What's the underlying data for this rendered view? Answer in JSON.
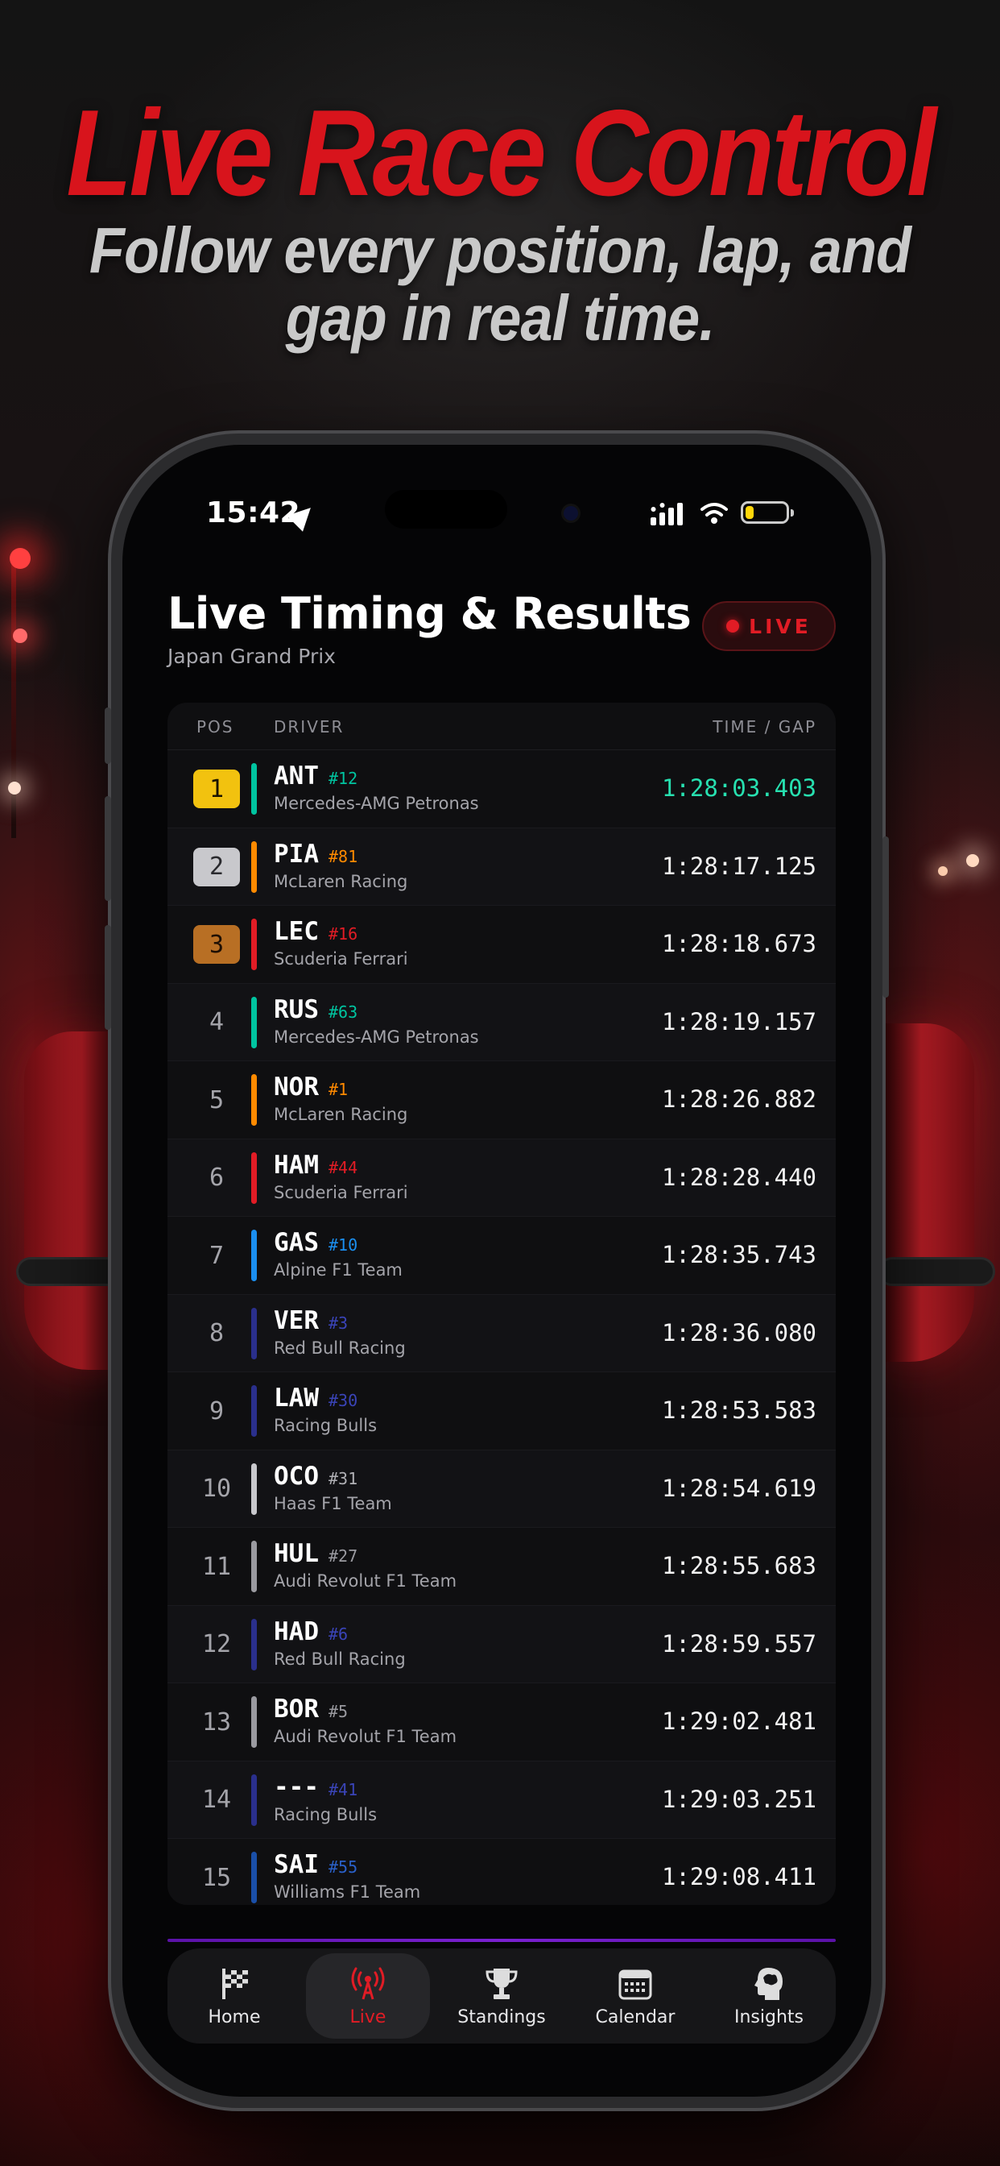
{
  "headline": {
    "title": "Live Race Control",
    "subtitle_line1": "Follow every position, lap, and",
    "subtitle_line2": "gap in real time."
  },
  "status_bar": {
    "time": "15:42"
  },
  "screen": {
    "title": "Live Timing & Results",
    "subtitle": "Japan Grand Prix",
    "live_badge": "LIVE"
  },
  "table": {
    "headers": {
      "pos": "POS",
      "driver": "DRIVER",
      "time": "TIME / GAP"
    },
    "rows": [
      {
        "pos": "1",
        "code": "ANT",
        "number": "#12",
        "team": "Mercedes-AMG Petronas",
        "time": "1:28:03.403",
        "team_color": "#00c4a0",
        "number_color": "#00c4a0",
        "leader": true
      },
      {
        "pos": "2",
        "code": "PIA",
        "number": "#81",
        "team": "McLaren Racing",
        "time": "1:28:17.125",
        "team_color": "#ff8a00",
        "number_color": "#ff8a00"
      },
      {
        "pos": "3",
        "code": "LEC",
        "number": "#16",
        "team": "Scuderia Ferrari",
        "time": "1:28:18.673",
        "team_color": "#e11c25",
        "number_color": "#e11c25"
      },
      {
        "pos": "4",
        "code": "RUS",
        "number": "#63",
        "team": "Mercedes-AMG Petronas",
        "time": "1:28:19.157",
        "team_color": "#00c4a0",
        "number_color": "#00c4a0"
      },
      {
        "pos": "5",
        "code": "NOR",
        "number": "#1",
        "team": "McLaren Racing",
        "time": "1:28:26.882",
        "team_color": "#ff8a00",
        "number_color": "#ff8a00"
      },
      {
        "pos": "6",
        "code": "HAM",
        "number": "#44",
        "team": "Scuderia Ferrari",
        "time": "1:28:28.440",
        "team_color": "#e11c25",
        "number_color": "#e11c25"
      },
      {
        "pos": "7",
        "code": "GAS",
        "number": "#10",
        "team": "Alpine F1 Team",
        "time": "1:28:35.743",
        "team_color": "#1b8ff0",
        "number_color": "#1b8ff0"
      },
      {
        "pos": "8",
        "code": "VER",
        "number": "#3",
        "team": "Red Bull Racing",
        "time": "1:28:36.080",
        "team_color": "#2a2f8c",
        "number_color": "#3a44b8"
      },
      {
        "pos": "9",
        "code": "LAW",
        "number": "#30",
        "team": "Racing Bulls",
        "time": "1:28:53.583",
        "team_color": "#2a2f8c",
        "number_color": "#3a44b8"
      },
      {
        "pos": "10",
        "code": "OCO",
        "number": "#31",
        "team": "Haas F1 Team",
        "time": "1:28:54.619",
        "team_color": "#c8c8cc",
        "number_color": "#b0b0b5"
      },
      {
        "pos": "11",
        "code": "HUL",
        "number": "#27",
        "team": "Audi Revolut F1 Team",
        "time": "1:28:55.683",
        "team_color": "#9a9aa0",
        "number_color": "#9a9aa0"
      },
      {
        "pos": "12",
        "code": "HAD",
        "number": "#6",
        "team": "Red Bull Racing",
        "time": "1:28:59.557",
        "team_color": "#2a2f8c",
        "number_color": "#3a44b8"
      },
      {
        "pos": "13",
        "code": "BOR",
        "number": "#5",
        "team": "Audi Revolut F1 Team",
        "time": "1:29:02.481",
        "team_color": "#9a9aa0",
        "number_color": "#9a9aa0"
      },
      {
        "pos": "14",
        "code": "---",
        "number": "#41",
        "team": "Racing Bulls",
        "time": "1:29:03.251",
        "team_color": "#2a2f8c",
        "number_color": "#3a44b8"
      },
      {
        "pos": "15",
        "code": "SAI",
        "number": "#55",
        "team": "Williams F1 Team",
        "time": "1:29:08.411",
        "team_color": "#1a4fa8",
        "number_color": "#2a60c8"
      }
    ]
  },
  "tabbar": {
    "items": [
      {
        "label": "Home",
        "icon": "checkered-flag-icon"
      },
      {
        "label": "Live",
        "icon": "broadcast-antenna-icon",
        "active": true
      },
      {
        "label": "Standings",
        "icon": "trophy-icon"
      },
      {
        "label": "Calendar",
        "icon": "calendar-icon"
      },
      {
        "label": "Insights",
        "icon": "brain-head-icon"
      }
    ]
  },
  "colors": {
    "accent": "#e11c25",
    "leader_time": "#27e0b0",
    "divider": "#7a20d0"
  }
}
